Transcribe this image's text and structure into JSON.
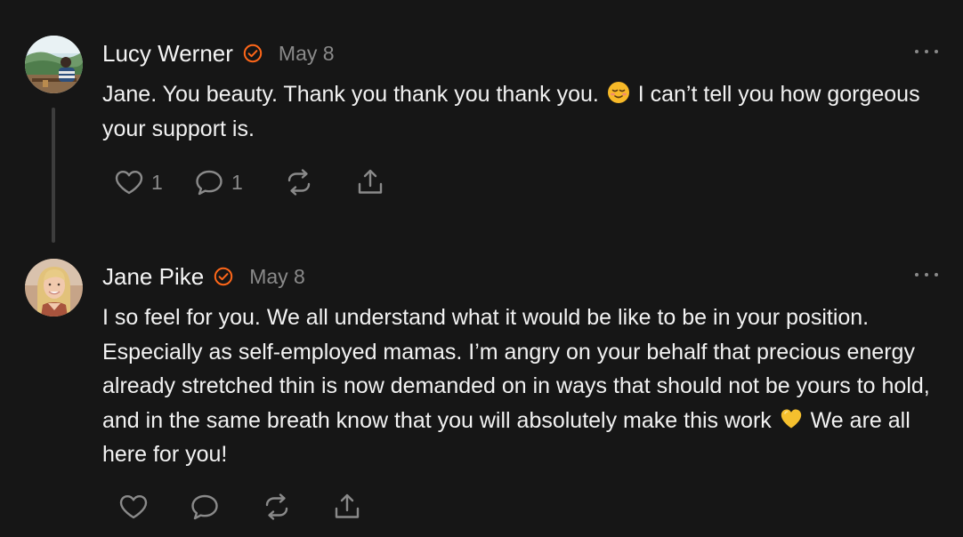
{
  "comments": [
    {
      "author": "Lucy Werner",
      "verified": true,
      "date": "May 8",
      "text_before_emoji": "Jane. You beauty. Thank you thank you thank you. ",
      "emoji": "relieved-face-emoji",
      "text_after_emoji": " I can’t tell you how gorgeous your support is.",
      "likes": "1",
      "replies": "1",
      "icons": [
        "heart-icon",
        "comment-icon",
        "restack-icon",
        "share-icon",
        "more-icon"
      ]
    },
    {
      "author": "Jane Pike",
      "verified": true,
      "date": "May 8",
      "text_before_emoji": "I so feel for you. We all understand what it would be like to be in your position. Especially as self-employed mamas. I’m angry on your behalf that precious energy already stretched thin is now demanded on in ways that should not be yours to hold, and in the same breath know that you will absolutely make this work ",
      "emoji": "yellow-heart-emoji",
      "text_after_emoji": " We are all here for you!",
      "likes": "",
      "replies": "",
      "icons": [
        "heart-icon",
        "comment-icon",
        "restack-icon",
        "share-icon",
        "more-icon"
      ]
    }
  ],
  "colors": {
    "background": "#161616",
    "text": "#f2f2f2",
    "muted": "#8a8a8a",
    "accent_verified": "#ff6719",
    "thread_line": "#3d3d3d"
  }
}
